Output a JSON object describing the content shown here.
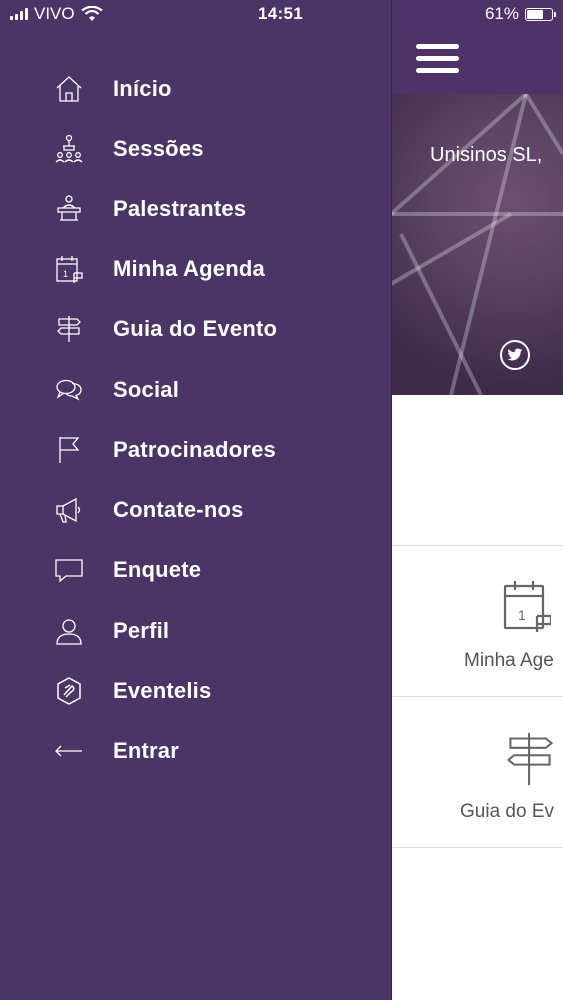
{
  "status_bar": {
    "carrier": "VIVO",
    "time": "14:51",
    "battery_percent": "61%",
    "battery_level": 0.61
  },
  "drawer": {
    "items": [
      {
        "label": "Início",
        "icon": "home-icon"
      },
      {
        "label": "Sessões",
        "icon": "sessions-icon"
      },
      {
        "label": "Palestrantes",
        "icon": "speaker-icon"
      },
      {
        "label": "Minha Agenda",
        "icon": "calendar-icon"
      },
      {
        "label": "Guia do Evento",
        "icon": "signpost-icon"
      },
      {
        "label": "Social",
        "icon": "chat-bubbles-icon"
      },
      {
        "label": "Patrocinadores",
        "icon": "flag-icon"
      },
      {
        "label": "Contate-nos",
        "icon": "megaphone-icon"
      },
      {
        "label": "Enquete",
        "icon": "comment-icon"
      },
      {
        "label": "Perfil",
        "icon": "user-icon"
      },
      {
        "label": "Eventelis",
        "icon": "eventelis-logo-icon"
      },
      {
        "label": "Entrar",
        "icon": "arrow-left-icon"
      }
    ]
  },
  "main": {
    "organizer": "Unisinos SL,",
    "tiles": [
      {
        "label": "Minha Age",
        "icon": "calendar-icon"
      },
      {
        "label": "Guia do Ev",
        "icon": "signpost-icon"
      }
    ]
  },
  "colors": {
    "drawer_bg": "#4b3466",
    "header_bg": "#4d3367",
    "text": "#ffffff"
  }
}
